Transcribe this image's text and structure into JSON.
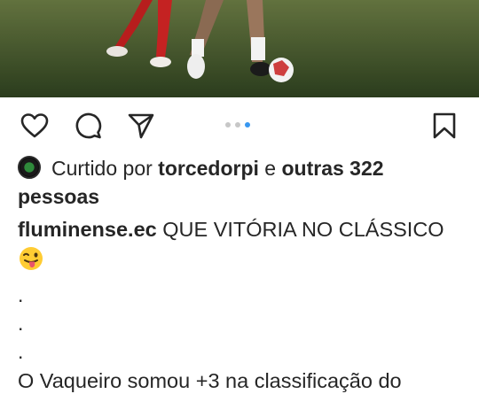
{
  "post": {
    "liked_by_prefix": "Curtido por",
    "liked_by_user": "torcedorpi",
    "liked_by_conjunction": "e",
    "liked_by_others": "outras 322",
    "liked_by_suffix": "pessoas",
    "username": "fluminense.ec",
    "caption_line1": "QUE VITÓRIA NO CLÁSSICO",
    "caption_dots": [
      ".",
      ".",
      "."
    ],
    "caption_body": "O Vaqueiro somou +3 na classificação do"
  },
  "carousel": {
    "total": 3,
    "active_index": 3
  },
  "icons": {
    "like": "heart-outline-icon",
    "comment": "comment-bubble-icon",
    "share": "paper-plane-icon",
    "save": "bookmark-outline-icon",
    "emoji": "winking-face-tongue-emoji"
  },
  "colors": {
    "text": "#262626",
    "carousel_active": "#3897f0",
    "carousel_inactive": "#c7c7c7"
  }
}
